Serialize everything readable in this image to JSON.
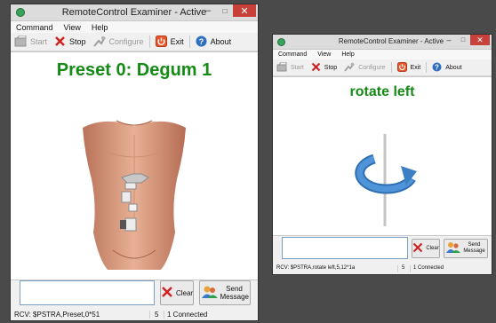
{
  "windows": [
    {
      "id": "left",
      "title": "RemoteControl Examiner - Active",
      "menu": [
        "Command",
        "View",
        "Help"
      ],
      "toolbar": {
        "start": "Start",
        "stop": "Stop",
        "configure": "Configure",
        "exit": "Exit",
        "about": "About"
      },
      "heading": "Preset 0: Degum 1",
      "message_input": "",
      "buttons": {
        "clear": "Clear",
        "send": "Send Message"
      },
      "status": {
        "rcv": "RCV: $PSTRA,Preset,0*51",
        "count": "5",
        "connected": "1 Connected"
      }
    },
    {
      "id": "right",
      "title": "RemoteControl Examiner - Active",
      "menu": [
        "Command",
        "View",
        "Help"
      ],
      "toolbar": {
        "start": "Start",
        "stop": "Stop",
        "configure": "Configure",
        "exit": "Exit",
        "about": "About"
      },
      "heading": "rotate left",
      "message_input": "",
      "buttons": {
        "clear": "Clear",
        "send": "Send Message"
      },
      "status": {
        "rcv": "RCV: $PSTRA,rotate left,5,12*1a",
        "count": "5",
        "connected": "1 Connected"
      }
    }
  ],
  "icons": {
    "start": "start-icon",
    "stop": "stop-x-icon",
    "configure": "configure-icon",
    "exit": "power-exit-icon",
    "about": "help-about-icon",
    "clear": "clear-x-icon",
    "send": "users-send-icon",
    "rotate": "rotate-left-icon",
    "torso": "torso-electrodes-image"
  },
  "colors": {
    "heading": "#168a16",
    "close_button": "#c7403a",
    "desktop": "#4a4a4a",
    "rotate_arrow": "#3b7fc4"
  }
}
